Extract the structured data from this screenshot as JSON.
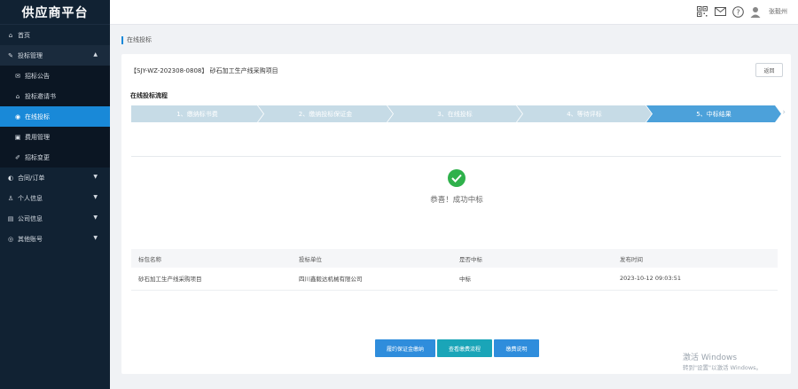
{
  "brand": "供应商平台",
  "sidebar": {
    "items": [
      {
        "label": "首页",
        "icon": "home-icon",
        "glyph": "⌂"
      },
      {
        "label": "投标管理",
        "icon": "wrench-icon",
        "glyph": "✎",
        "arrow": "▲"
      },
      {
        "label": "招标公告",
        "icon": "mail-icon",
        "glyph": "✉"
      },
      {
        "label": "投标邀请书",
        "icon": "inbox-icon",
        "glyph": "⌂"
      },
      {
        "label": "在线投标",
        "icon": "target-icon",
        "glyph": "◉"
      },
      {
        "label": "费用管理",
        "icon": "money-icon",
        "glyph": "▣"
      },
      {
        "label": "招标变更",
        "icon": "pencil-icon",
        "glyph": "✐"
      },
      {
        "label": "合同/订单",
        "icon": "contract-icon",
        "glyph": "◐",
        "arrow": "▼"
      },
      {
        "label": "个人信息",
        "icon": "user-icon",
        "glyph": "♙",
        "arrow": "▼"
      },
      {
        "label": "公司信息",
        "icon": "building-icon",
        "glyph": "▤",
        "arrow": "▼"
      },
      {
        "label": "其他账号",
        "icon": "account-icon",
        "glyph": "◎",
        "arrow": "▼"
      }
    ]
  },
  "header": {
    "icons": [
      "qrcode-icon",
      "mail-icon",
      "help-icon",
      "user-avatar-icon"
    ],
    "username": "张毅州"
  },
  "breadcrumb": "在线投标",
  "project": {
    "title": "【SJY-WZ-202308-0808】 砂石加工生产线采购项目",
    "back_label": "返回"
  },
  "flow": {
    "label": "在线投标流程",
    "steps": [
      "1、缴纳标书费",
      "2、缴纳投标保证金",
      "3、在线投标",
      "4、等待评标",
      "5、中标结果"
    ],
    "active_index": 4
  },
  "result": {
    "message": "恭喜！成功中标"
  },
  "table": {
    "headers": [
      "标包名称",
      "投标单位",
      "是否中标",
      "发布时间"
    ],
    "rows": [
      [
        "砂石加工生产线采购项目",
        "四川鑫毅达机械有限公司",
        "中标",
        "2023-10-12 09:03:51"
      ]
    ]
  },
  "buttons": [
    "履约保证金缴纳",
    "查看缴费流程",
    "缴费说明"
  ],
  "colors": {
    "sidebar_bg": "#112233",
    "active_blue": "#1989d8",
    "step_active": "#4ca1da",
    "step_inactive": "#c6dbe6",
    "success_green": "#2fb14b"
  },
  "watermark": {
    "line1": "激活 Windows",
    "line2": "转到\"设置\"以激活 Windows。"
  }
}
